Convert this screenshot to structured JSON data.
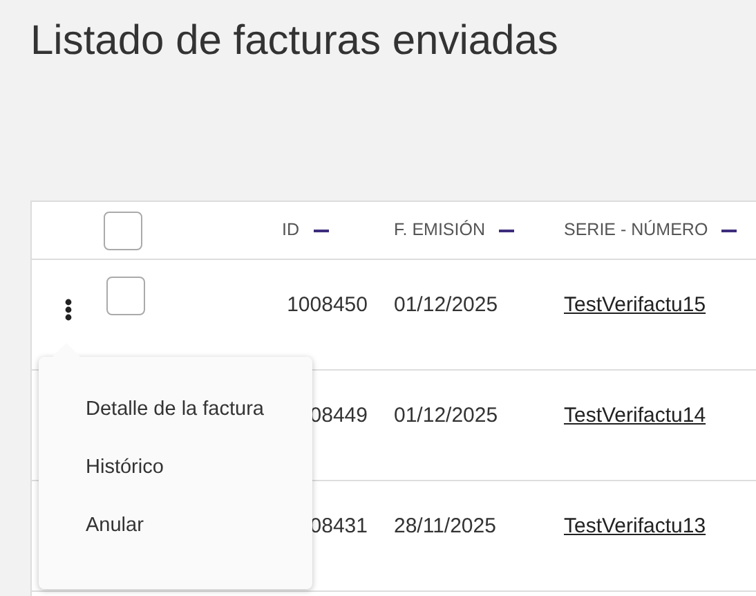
{
  "title": "Listado de facturas enviadas",
  "table": {
    "select_all": {
      "checked": false
    },
    "columns": [
      {
        "label": "ID",
        "sortable": true
      },
      {
        "label": "F. EMISIÓN",
        "sortable": true
      },
      {
        "label": "SERIE - NÚMERO",
        "sortable": true
      }
    ],
    "rows": [
      {
        "id": "1008450",
        "date": "01/12/2025",
        "serie": "TestVerifactu15",
        "actions": true,
        "checked": false
      },
      {
        "id": "08449",
        "date": "01/12/2025",
        "serie": "TestVerifactu14"
      },
      {
        "id": "08431",
        "date": "28/11/2025",
        "serie": "TestVerifactu13"
      }
    ]
  },
  "menu": {
    "items": [
      "Detalle de la factura",
      "Histórico",
      "Anular"
    ]
  }
}
